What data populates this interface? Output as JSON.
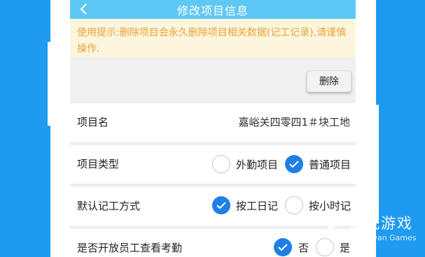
{
  "header": {
    "title": "修改项目信息",
    "back_icon": "chevron-left-icon"
  },
  "notice": {
    "text": "使用提示:删除项目会永久删除项目相关数据(记工记录),请谨慎操作."
  },
  "actions": {
    "delete_label": "删除"
  },
  "fields": {
    "project_name": {
      "label": "项目名",
      "value": "嘉峪关四零四1＃块工地"
    },
    "project_type": {
      "label": "项目类型",
      "options": [
        {
          "label": "外勤项目",
          "selected": false
        },
        {
          "label": "普通项目",
          "selected": true
        }
      ]
    },
    "default_method": {
      "label": "默认记工方式",
      "options": [
        {
          "label": "按工日记",
          "selected": true
        },
        {
          "label": "按小时记",
          "selected": false
        }
      ]
    },
    "attendance_visible": {
      "label": "是否开放员工查看考勤",
      "options": [
        {
          "label": "否",
          "selected": true
        },
        {
          "label": "是",
          "selected": false
        }
      ]
    }
  },
  "watermark": {
    "name": "仍玩游戏",
    "subtitle": "Rengwan Games"
  },
  "colors": {
    "background": "#1e9bf0",
    "titlebar": "#5ec8f5",
    "notice_bg": "#fdf5dc",
    "notice_text": "#e8a33a",
    "checked": "#1e7fe6"
  }
}
